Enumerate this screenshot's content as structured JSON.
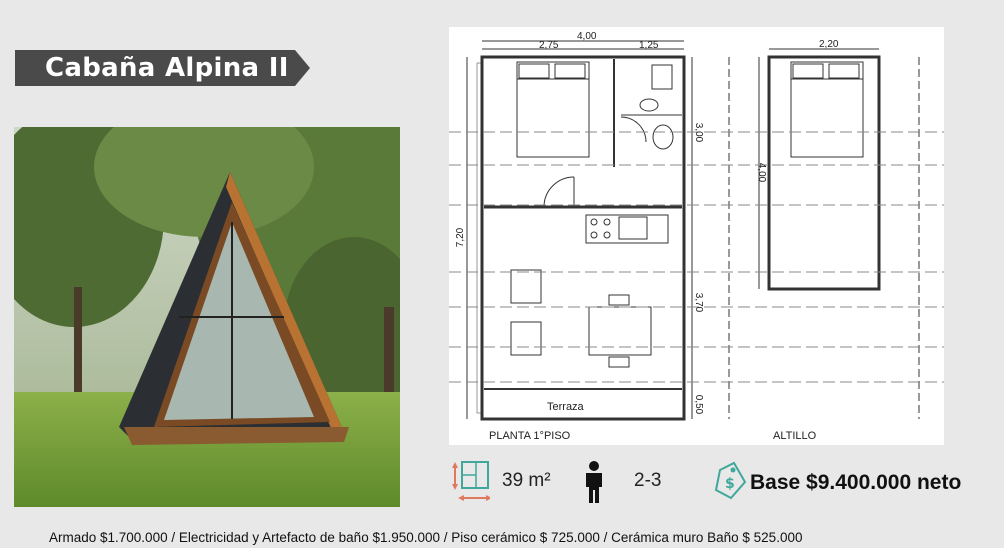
{
  "title": "Cabaña Alpina II",
  "plan": {
    "floor_label": "PLANTA 1°PISO",
    "loft_label": "ALTILLO",
    "terrace_label": "Terraza",
    "dims": {
      "total_width": "4,00",
      "left_width": "2,75",
      "right_width": "1,25",
      "total_height": "7,20",
      "top_height": "3,00",
      "mid_height": "3,70",
      "bottom_height": "0,50",
      "loft_width": "2,20",
      "loft_height": "4,00"
    }
  },
  "specs": {
    "area": "39 m²",
    "people": "2-3",
    "price": "Base $9.400.000 neto"
  },
  "footer": "Armado $1.700.000 / Electricidad y Artefacto de baño $1.950.000 / Piso cerámico $ 725.000 / Cerámica muro Baño  $ 525.000",
  "icons": [
    "area-icon",
    "person-icon",
    "price-tag-icon"
  ],
  "colors": {
    "banner": "#4a4a4a",
    "area_icon": "#e07a5f",
    "tag_icon": "#3fa89a"
  }
}
